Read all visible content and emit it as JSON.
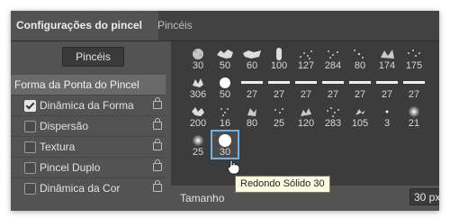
{
  "tabs": [
    {
      "label": "Configurações do pincel",
      "active": true
    },
    {
      "label": "Pincéis",
      "active": false
    }
  ],
  "left_panel": {
    "pinceis_button": "Pincéis",
    "forma_label": "Forma da Ponta do Pincel",
    "options": [
      {
        "label": "Dinâmica da Forma",
        "checked": true
      },
      {
        "label": "Dispersão",
        "checked": false
      },
      {
        "label": "Textura",
        "checked": false
      },
      {
        "label": "Pincel Duplo",
        "checked": false
      },
      {
        "label": "Dinâmica da Cor",
        "checked": false
      }
    ]
  },
  "brush_grid": [
    [
      "30",
      "50",
      "60",
      "100",
      "127",
      "284",
      "80",
      "174",
      "175"
    ],
    [
      "306",
      "50",
      "27",
      "27",
      "27",
      "27",
      "27",
      "27",
      "27"
    ],
    [
      "200",
      "16",
      "80",
      "25",
      "120",
      "283",
      "105",
      "3",
      "21"
    ],
    [
      "25",
      "30"
    ]
  ],
  "tooltip": "Redondo Sólido 30",
  "size": {
    "label": "Tamanho",
    "value": "30 px"
  }
}
